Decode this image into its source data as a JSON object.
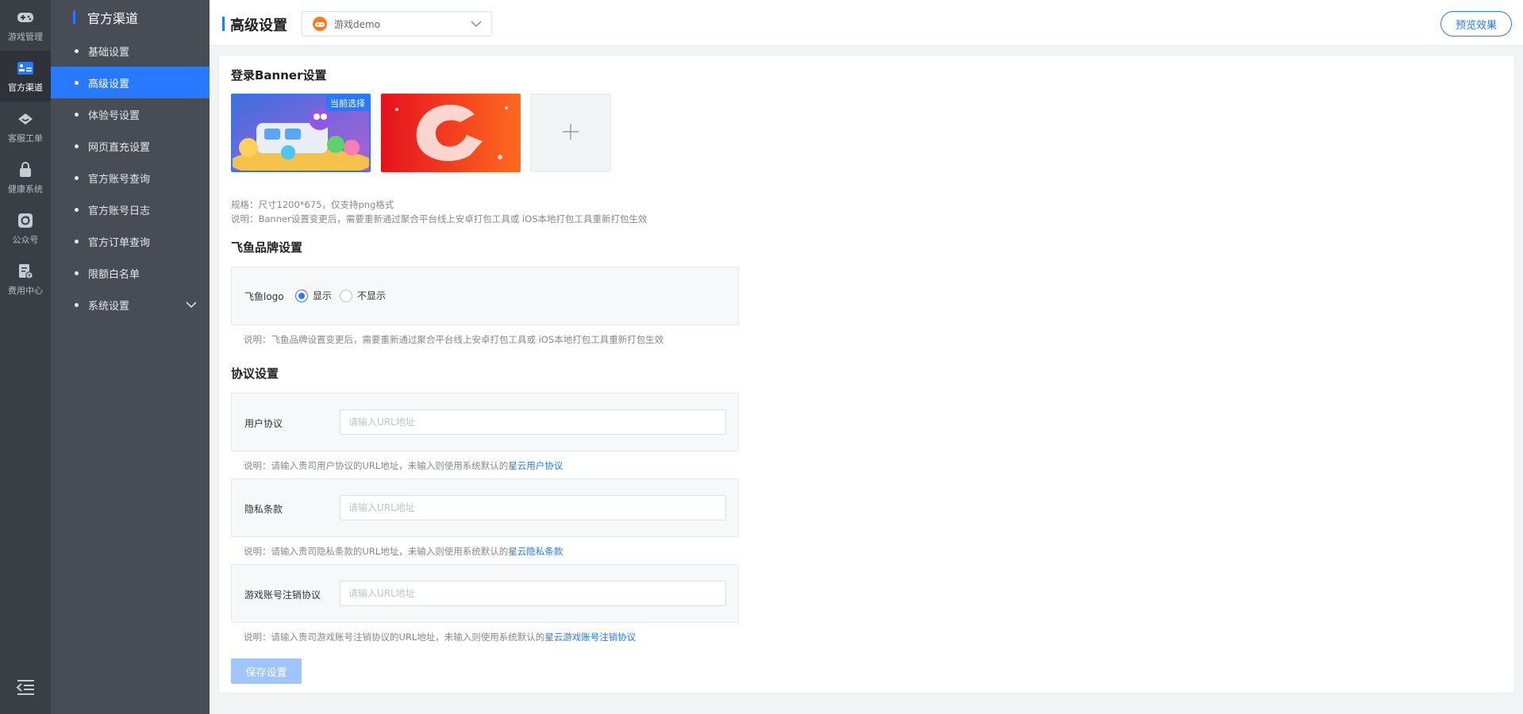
{
  "rail": {
    "items": [
      {
        "label": "游戏管理",
        "icon": "gamepad-icon"
      },
      {
        "label": "官方渠道",
        "icon": "channel-card-icon"
      },
      {
        "label": "客服工单",
        "icon": "service-icon"
      },
      {
        "label": "健康系统",
        "icon": "lock-icon"
      },
      {
        "label": "公众号",
        "icon": "refresh-icon"
      },
      {
        "label": "费用中心",
        "icon": "bill-icon"
      }
    ],
    "active_index": 1,
    "collapse_icon": "collapse-menu-icon"
  },
  "subnav": {
    "title": "官方渠道",
    "items": [
      {
        "label": "基础设置"
      },
      {
        "label": "高级设置"
      },
      {
        "label": "体验号设置"
      },
      {
        "label": "网页直充设置"
      },
      {
        "label": "官方账号查询"
      },
      {
        "label": "官方账号日志"
      },
      {
        "label": "官方订单查询"
      },
      {
        "label": "限额白名单"
      },
      {
        "label": "系统设置"
      }
    ],
    "active_index": 1
  },
  "header": {
    "title": "高级设置",
    "game_select": "游戏demo",
    "preview_button": "预览效果"
  },
  "banner_section": {
    "title": "登录Banner设置",
    "current_badge": "当前选择",
    "spec_hint": "规格：尺寸1200*675，仅支持png格式",
    "note_hint": "说明：Banner设置变更后，需要重新通过聚合平台线上安卓打包工具或 iOS本地打包工具重新打包生效"
  },
  "brand_section": {
    "title": "飞鱼品牌设置",
    "logo_label": "飞鱼logo",
    "show_option": "显示",
    "hide_option": "不显示",
    "selected": "显示",
    "note": "说明：飞鱼品牌设置变更后，需要重新通过聚合平台线上安卓打包工具或 iOS本地打包工具重新打包生效"
  },
  "agreement_section": {
    "title": "协议设置",
    "placeholder": "请输入URL地址",
    "user_agreement": {
      "label": "用户协议",
      "value": "",
      "note_prefix": "说明：请输入贵司用户协议的URL地址，未输入则使用系统默认的",
      "note_link": "星云用户协议"
    },
    "privacy_policy": {
      "label": "隐私条款",
      "value": "",
      "note_prefix": "说明：请输入贵司隐私条款的URL地址，未输入则使用系统默认的",
      "note_link": "星云隐私条款"
    },
    "cancel_agreement": {
      "label": "游戏账号注销协议",
      "value": "",
      "note_prefix": "说明：请输入贵司游戏账号注销协议的URL地址，未输入则使用系统默认的",
      "note_link": "星云游戏账号注销协议"
    }
  },
  "save_button": "保存设置",
  "colors": {
    "accent": "#2979ff",
    "rail_bg": "#3a3e45",
    "subnav_bg": "#484c54",
    "save_disabled": "#a0c4fc"
  }
}
